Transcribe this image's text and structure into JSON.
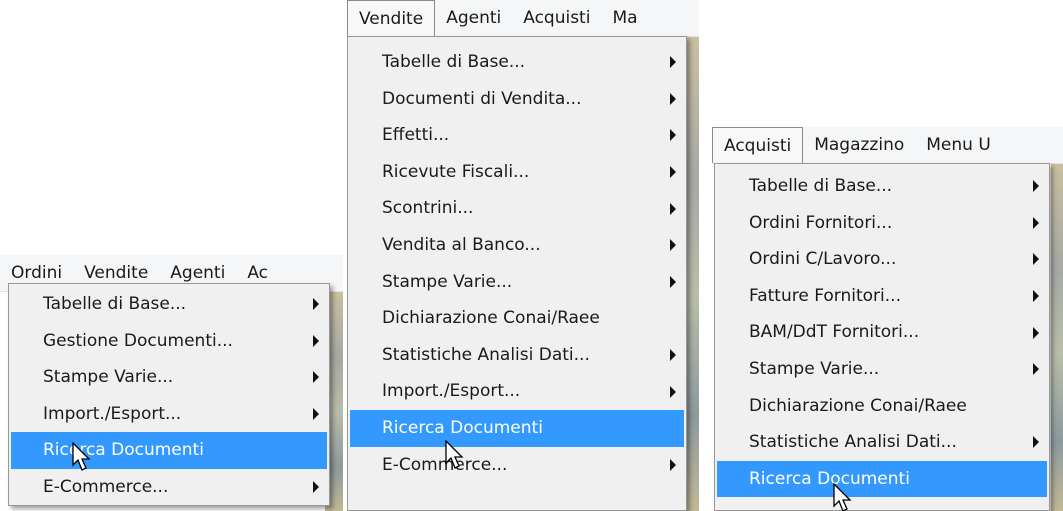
{
  "panels": [
    {
      "menubar": [
        "Ordini",
        "Vendite",
        "Agenti",
        "Ac"
      ],
      "items": [
        {
          "label": "Tabelle di Base...",
          "submenu": true
        },
        {
          "label": "Gestione Documenti...",
          "submenu": true
        },
        {
          "label": "Stampe Varie...",
          "submenu": true
        },
        {
          "label": "Import./Esport...",
          "submenu": true
        },
        {
          "label": "Ricerca Documenti",
          "submenu": false,
          "highlighted": true
        },
        {
          "label": "E-Commerce...",
          "submenu": true
        }
      ]
    },
    {
      "menubar": [
        "Vendite",
        "Agenti",
        "Acquisti",
        "Ma"
      ],
      "items": [
        {
          "label": "Tabelle di Base...",
          "submenu": true
        },
        {
          "label": "Documenti di Vendita...",
          "submenu": true
        },
        {
          "label": "Effetti...",
          "submenu": true
        },
        {
          "label": "Ricevute Fiscali...",
          "submenu": true
        },
        {
          "label": "Scontrini...",
          "submenu": true
        },
        {
          "label": "Vendita al Banco...",
          "submenu": true
        },
        {
          "label": "Stampe Varie...",
          "submenu": true
        },
        {
          "label": "Dichiarazione Conai/Raee",
          "submenu": false
        },
        {
          "label": "Statistiche Analisi Dati...",
          "submenu": true
        },
        {
          "label": "Import./Esport...",
          "submenu": true
        },
        {
          "label": "Ricerca Documenti",
          "submenu": false,
          "highlighted": true
        },
        {
          "label": "E-Commerce...",
          "submenu": true
        }
      ]
    },
    {
      "menubar": [
        "Acquisti",
        "Magazzino",
        "Menu U"
      ],
      "items": [
        {
          "label": "Tabelle di Base...",
          "submenu": true
        },
        {
          "label": "Ordini Fornitori...",
          "submenu": true
        },
        {
          "label": "Ordini C/Lavoro...",
          "submenu": true
        },
        {
          "label": "Fatture Fornitori...",
          "submenu": true
        },
        {
          "label": "BAM/DdT Fornitori...",
          "submenu": true
        },
        {
          "label": "Stampe Varie...",
          "submenu": true
        },
        {
          "label": "Dichiarazione Conai/Raee",
          "submenu": false
        },
        {
          "label": "Statistiche Analisi Dati...",
          "submenu": true
        },
        {
          "label": "Ricerca Documenti",
          "submenu": false,
          "highlighted": true
        }
      ]
    }
  ],
  "colors": {
    "highlight": "#3399ff",
    "menu_bg": "#f0f0f0",
    "menubar_bg": "#f5f6f7"
  }
}
